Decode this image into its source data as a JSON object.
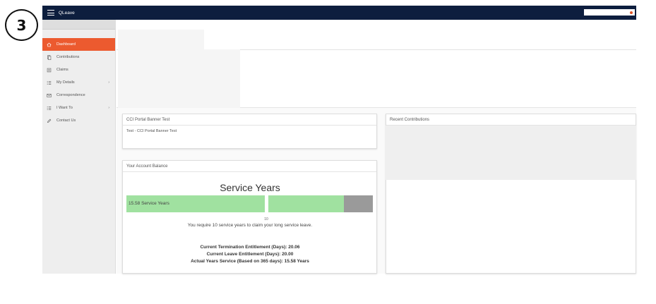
{
  "step": {
    "number": "3"
  },
  "app": {
    "title": "QLeave"
  },
  "colors": {
    "topbar": "#0d1e3e",
    "accent": "#ec5a2f",
    "bar_green": "#a0e1a0",
    "bar_grey": "#9a9a9a"
  },
  "sidebar": {
    "items": [
      {
        "label": "Dashboard",
        "icon": "home-icon",
        "active": true
      },
      {
        "label": "Contributions",
        "icon": "document-icon"
      },
      {
        "label": "Claims",
        "icon": "form-icon"
      },
      {
        "label": "My Details",
        "icon": "list-icon",
        "has_children": true
      },
      {
        "label": "Correspondence",
        "icon": "mail-icon"
      },
      {
        "label": "I Want To",
        "icon": "list-icon",
        "has_children": true
      },
      {
        "label": "Contact Us",
        "icon": "pencil-icon"
      }
    ],
    "chevron": "›"
  },
  "banner_card": {
    "title": "CCI Portal Banner Test",
    "body": "Test - CCI Portal Banner Test"
  },
  "contributions_card": {
    "title": "Recent Contributions"
  },
  "balance_card": {
    "title": "Your Account Balance",
    "heading": "Service Years",
    "bar_label": "15.58 Service Years",
    "service_years": 15.58,
    "threshold": 10,
    "tick_label": "10",
    "requirement_text": "You require 10 service years to claim your long service leave.",
    "termination_entitlement": "Current Termination Entitlement (Days): 20.06",
    "leave_entitlement": "Current Leave Entitlement (Days): 20.00",
    "actual_years": "Actual Years Service (Based on 365 days): 15.58 Years"
  }
}
